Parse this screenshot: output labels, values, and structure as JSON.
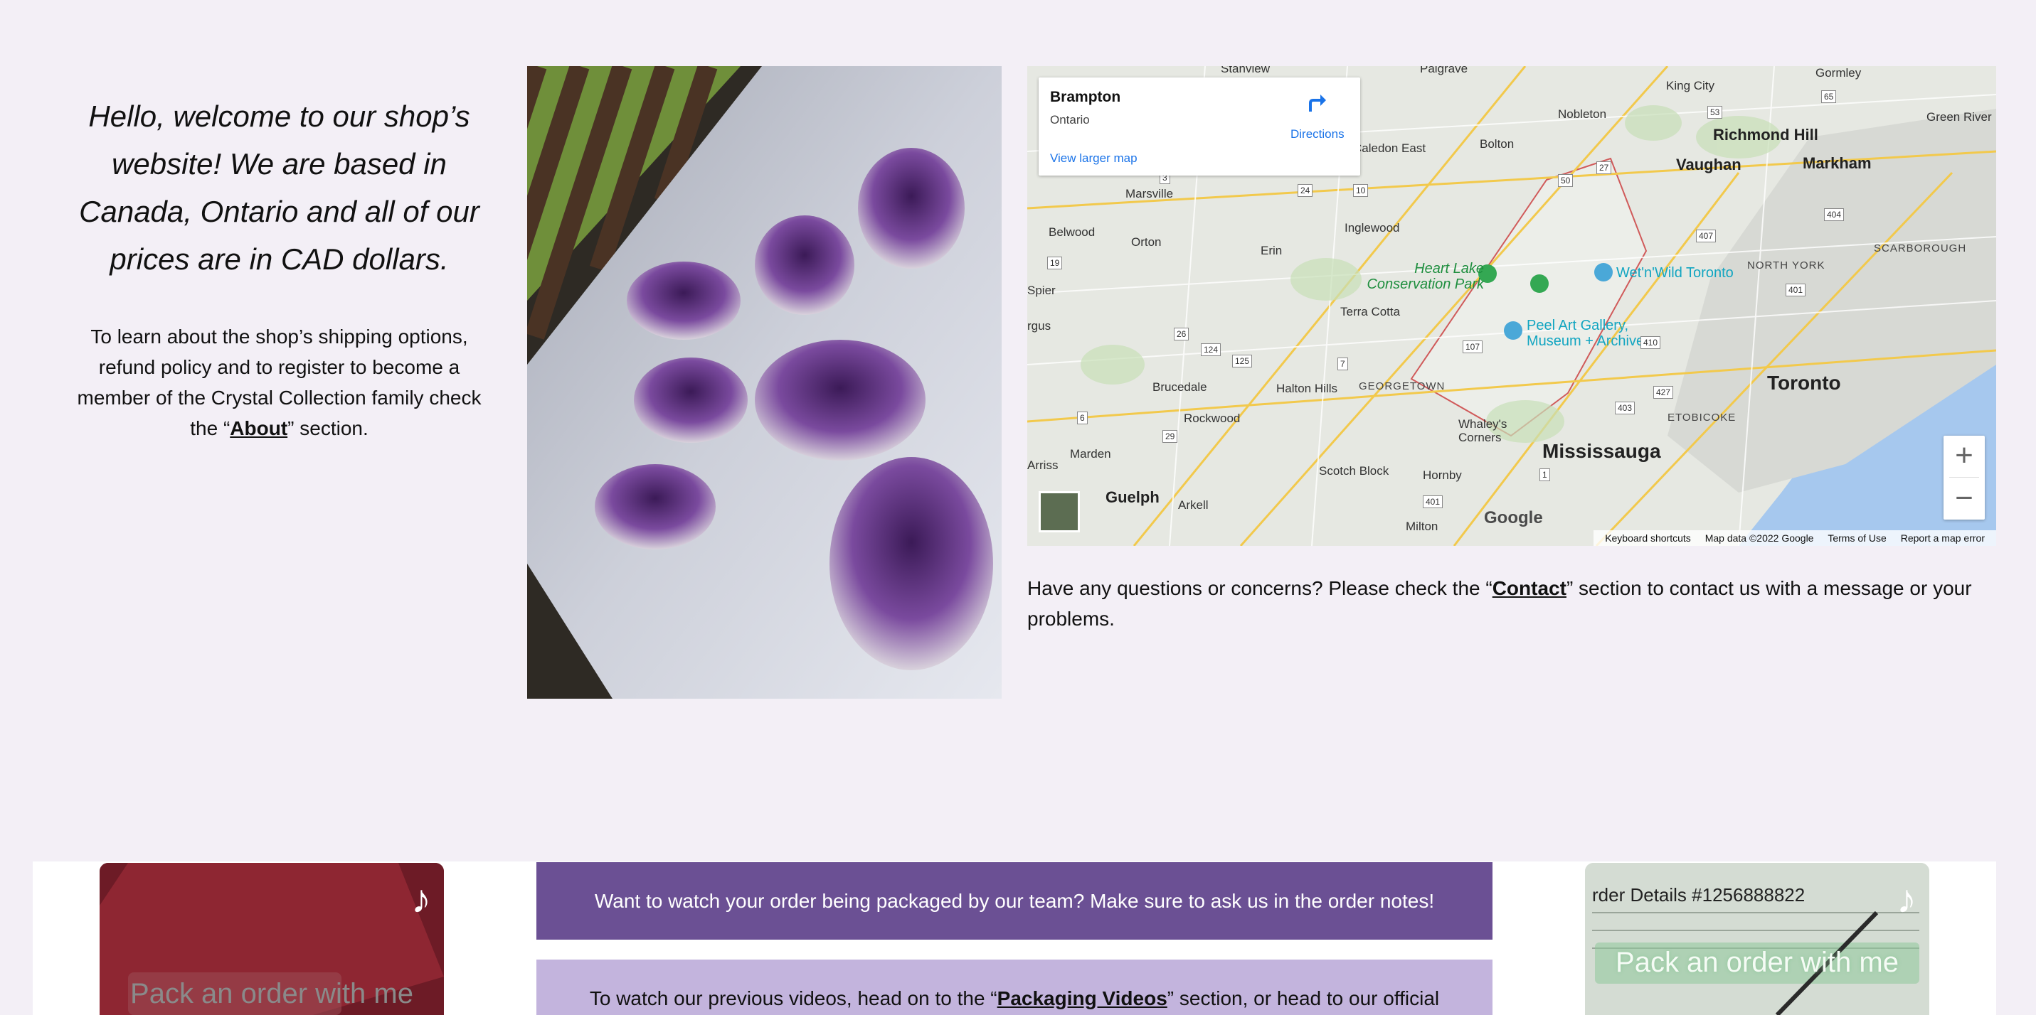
{
  "welcome": {
    "title": "Hello, welcome to our shop’s website! We are based in Canada, Ontario and all of our prices are in CAD dollars.",
    "body_pre": "To learn about the shop’s shipping options, refund policy and to register to become a member of the Crystal Collection family check the “",
    "body_link": "About",
    "body_post": "” section."
  },
  "map": {
    "place": "Brampton",
    "region": "Ontario",
    "directions_label": "Directions",
    "larger_map_label": "View larger map",
    "zoom_in": "+",
    "zoom_out": "−",
    "google_logo": "Google",
    "attribution": [
      "Keyboard shortcuts",
      "Map data ©2022 Google",
      "Terms of Use",
      "Report a map error"
    ],
    "labels": {
      "toronto": "Toronto",
      "mississauga": "Mississauga",
      "richmond_hill": "Richmond Hill",
      "vaughan": "Vaughan",
      "markham": "Markham",
      "guelph": "Guelph",
      "king_city": "King City",
      "nobleton": "Nobleton",
      "gormley": "Gormley",
      "green_river": "Green River",
      "bolton": "Bolton",
      "caledon_east": "Caledon East",
      "palgrave": "Palgrave",
      "stanview": "Stanview",
      "marsville": "Marsville",
      "belwood": "Belwood",
      "orton": "Orton",
      "erin": "Erin",
      "inglewood": "Inglewood",
      "spier": "Spier",
      "terra_cotta": "Terra Cotta",
      "argus": "rgus",
      "brucedale": "Brucedale",
      "halton_hills": "Halton Hills",
      "georgetown": "GEORGETOWN",
      "rockwood": "Rockwood",
      "marden": "Marden",
      "arriss": "Arriss",
      "arkell": "Arkell",
      "scotch_block": "Scotch Block",
      "hornby": "Hornby",
      "milton": "Milton",
      "whaleys_corners": "Whaley's Corners",
      "etobicoke": "ETOBICOKE",
      "north_york": "NORTH YORK",
      "scarborough": "SCARBOROUGH",
      "heart_lake": "Heart Lake Conservation Park",
      "peel_art": "Peel Art Gallery, Museum + Archives",
      "wet_n_wild": "Wet'n'Wild Toronto"
    },
    "shields": [
      "50",
      "27",
      "53",
      "65",
      "407",
      "404",
      "401",
      "10",
      "24",
      "19",
      "26",
      "124",
      "125",
      "7",
      "6",
      "29",
      "107",
      "410",
      "427",
      "403",
      "401",
      "1",
      "3"
    ]
  },
  "questions": {
    "pre": "Have any questions or concerns? Please check the “",
    "link": "Contact",
    "post": "” section to contact us with a message or your problems."
  },
  "banners": {
    "purple": "Want to watch your order being packaged by our team? Make sure to ask us in the order notes!",
    "lilac_pre": "To watch our previous videos, head on to the “",
    "lilac_link": "Packaging Videos",
    "lilac_post": "” section, or head to our official"
  },
  "tiktok_left": {
    "caption": "Pack an order with me"
  },
  "tiktok_right": {
    "caption": "Pack an order with me",
    "order_details": "rder Details #1256888822"
  },
  "colors": {
    "background": "#f3eff6",
    "purple": "#6b5094",
    "lilac": "#c3b4dd",
    "map_link": "#1a73e8"
  }
}
